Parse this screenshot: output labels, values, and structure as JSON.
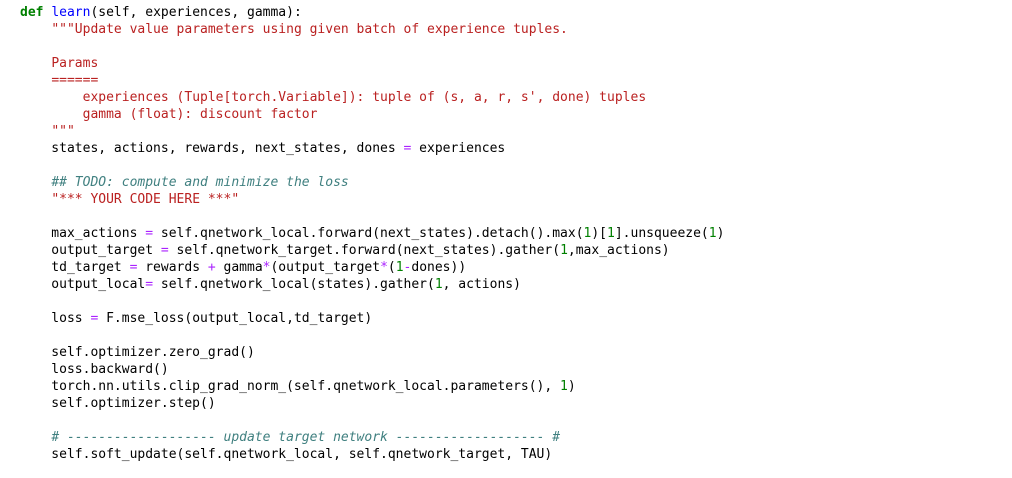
{
  "code": {
    "lines": [
      [
        [
          "kw",
          "def"
        ],
        [
          "plain",
          " "
        ],
        [
          "def",
          "learn"
        ],
        [
          "plain",
          "(self, experiences, gamma):"
        ]
      ],
      [
        [
          "plain",
          "    "
        ],
        [
          "str",
          "\"\"\"Update value parameters using given batch of experience tuples."
        ]
      ],
      [],
      [
        [
          "plain",
          "    "
        ],
        [
          "str",
          "Params"
        ]
      ],
      [
        [
          "plain",
          "    "
        ],
        [
          "str",
          "======"
        ]
      ],
      [
        [
          "plain",
          "        "
        ],
        [
          "str",
          "experiences (Tuple[torch.Variable]): tuple of (s, a, r, s', done) tuples"
        ]
      ],
      [
        [
          "plain",
          "        "
        ],
        [
          "str",
          "gamma (float): discount factor"
        ]
      ],
      [
        [
          "plain",
          "    "
        ],
        [
          "str",
          "\"\"\""
        ]
      ],
      [
        [
          "plain",
          "    states, actions, rewards, next_states, dones "
        ],
        [
          "op",
          "="
        ],
        [
          "plain",
          " experiences"
        ]
      ],
      [],
      [
        [
          "plain",
          "    "
        ],
        [
          "cm",
          "## TODO: compute and minimize the loss"
        ]
      ],
      [
        [
          "plain",
          "    "
        ],
        [
          "str",
          "\"*** YOUR CODE HERE ***\""
        ]
      ],
      [],
      [
        [
          "plain",
          "    max_actions "
        ],
        [
          "op",
          "="
        ],
        [
          "plain",
          " self.qnetwork_local.forward(next_states).detach().max("
        ],
        [
          "num",
          "1"
        ],
        [
          "plain",
          ")["
        ],
        [
          "num",
          "1"
        ],
        [
          "plain",
          "].unsqueeze("
        ],
        [
          "num",
          "1"
        ],
        [
          "plain",
          ")"
        ]
      ],
      [
        [
          "plain",
          "    output_target "
        ],
        [
          "op",
          "="
        ],
        [
          "plain",
          " self.qnetwork_target.forward(next_states).gather("
        ],
        [
          "num",
          "1"
        ],
        [
          "plain",
          ",max_actions)"
        ]
      ],
      [
        [
          "plain",
          "    td_target "
        ],
        [
          "op",
          "="
        ],
        [
          "plain",
          " rewards "
        ],
        [
          "op",
          "+"
        ],
        [
          "plain",
          " gamma"
        ],
        [
          "op",
          "*"
        ],
        [
          "plain",
          "(output_target"
        ],
        [
          "op",
          "*"
        ],
        [
          "plain",
          "("
        ],
        [
          "num",
          "1"
        ],
        [
          "op",
          "-"
        ],
        [
          "plain",
          "dones))"
        ]
      ],
      [
        [
          "plain",
          "    output_local"
        ],
        [
          "op",
          "="
        ],
        [
          "plain",
          " self.qnetwork_local(states).gather("
        ],
        [
          "num",
          "1"
        ],
        [
          "plain",
          ", actions)"
        ]
      ],
      [],
      [
        [
          "plain",
          "    loss "
        ],
        [
          "op",
          "="
        ],
        [
          "plain",
          " F.mse_loss(output_local,td_target)"
        ]
      ],
      [],
      [
        [
          "plain",
          "    self.optimizer.zero_grad()"
        ]
      ],
      [
        [
          "plain",
          "    loss.backward()"
        ]
      ],
      [
        [
          "plain",
          "    torch.nn.utils.clip_grad_norm_(self.qnetwork_local.parameters(), "
        ],
        [
          "num",
          "1"
        ],
        [
          "plain",
          ")"
        ]
      ],
      [
        [
          "plain",
          "    self.optimizer.step()"
        ]
      ],
      [],
      [
        [
          "plain",
          "    "
        ],
        [
          "cm",
          "# ------------------- update target network ------------------- #"
        ]
      ],
      [
        [
          "plain",
          "    self.soft_update(self.qnetwork_local, self.qnetwork_target, TAU)"
        ]
      ]
    ]
  }
}
